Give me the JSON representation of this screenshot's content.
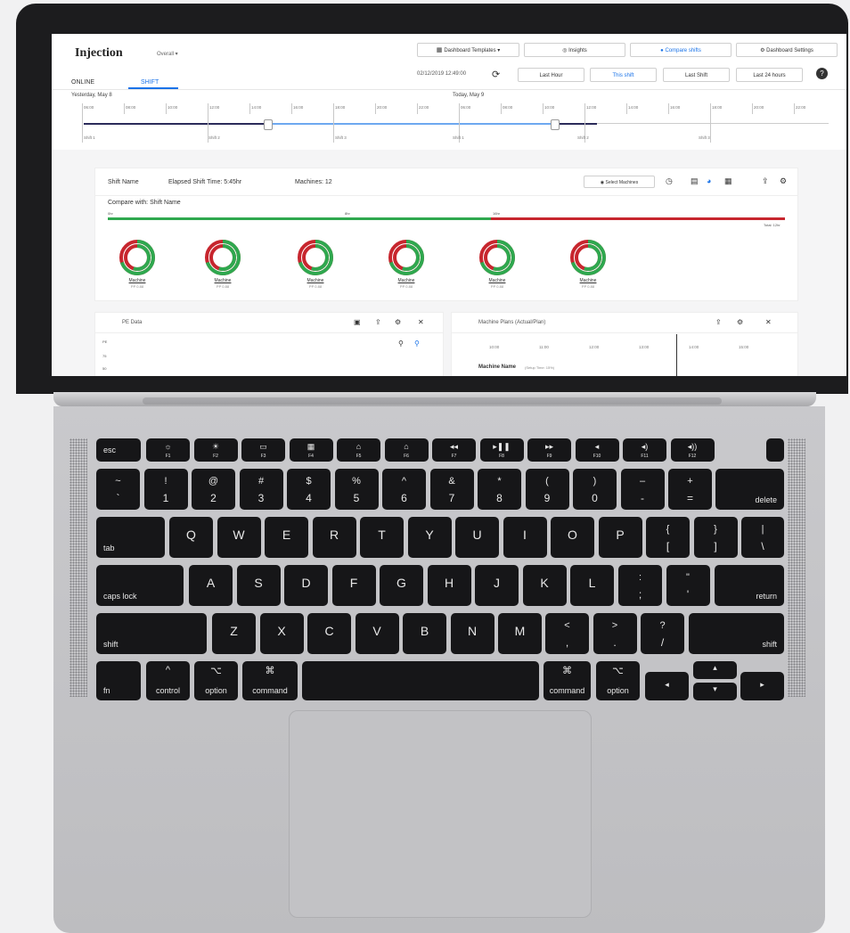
{
  "app": {
    "title": "Injection",
    "title_sub": "Overall ▾",
    "toolbar": {
      "templates": "Dashboard Templates ▾",
      "insights": "Insights",
      "compare": "Compare shifts",
      "settings": "Dashboard Settings"
    },
    "tabs": [
      "ONLINE",
      "SHIFT"
    ],
    "datetime": "02/12/2019 12:49:00",
    "ranges": [
      "Last Hour",
      "This shift",
      "Last Shift",
      "Last 24 hours"
    ],
    "help": "?",
    "timeline": {
      "left_day": "Yesterday, May 8",
      "right_day": "Today, May 9",
      "ticks": [
        "06:00",
        "08:00",
        "10:00",
        "12:00",
        "14:00",
        "16:00",
        "18:00",
        "20:00",
        "22:00",
        "06:00",
        "08:00",
        "10:00",
        "12:00",
        "14:00",
        "16:00",
        "18:00",
        "20:00",
        "22:00"
      ],
      "shifts": [
        "Shift 1",
        "Shift 2",
        "Shift 3",
        "Shift 1",
        "Shift 2",
        "Shift 3"
      ]
    },
    "shift_bar": {
      "name": "Shift Name",
      "elapsed": "Elapsed Shift Time: 5:45hr",
      "machines": "Machines: 12",
      "select": "Select Machines",
      "compare_label": "Compare with: Shift Name",
      "markers": [
        "0hr",
        "8hr",
        "16hr"
      ],
      "total": "Total: 12hr"
    },
    "machines": [
      {
        "name": "Machine",
        "sub": "PP 0.88"
      },
      {
        "name": "Machine",
        "sub": "PP 0.88"
      },
      {
        "name": "Machine",
        "sub": "PP 0.88"
      },
      {
        "name": "Machine",
        "sub": "PP 0.88"
      },
      {
        "name": "Machine",
        "sub": "PP 0.88"
      },
      {
        "name": "Machine",
        "sub": "PP 0.88"
      }
    ],
    "pe_panel": {
      "title": "PE Data",
      "axis": [
        "PE",
        "75",
        "50"
      ]
    },
    "plan_panel": {
      "title": "Machine Plans (Actual/Plan)",
      "ticks": [
        "10:00",
        "11:00",
        "12:00",
        "13:00",
        "14:00",
        "15:00"
      ],
      "machine": "Machine Name",
      "machine_sub": "(Setup Time: 15%)"
    },
    "colors": {
      "accent": "#1a73e8",
      "good": "#2fa84f",
      "bad": "#c7262e"
    }
  },
  "keyboard": {
    "fn_row": [
      "esc",
      "F1",
      "F2",
      "F3",
      "F4",
      "F5",
      "F6",
      "F7",
      "F8",
      "F9",
      "F10",
      "F11",
      "F12"
    ],
    "fn_icons": [
      "",
      "☼",
      "☀",
      "▭",
      "▦",
      "⌂",
      "⌂",
      "◂◂",
      "▸❚❚",
      "▸▸",
      "◂",
      "◂)",
      "◂))"
    ],
    "num_row": [
      [
        "~",
        "`"
      ],
      [
        "!",
        "1"
      ],
      [
        "@",
        "2"
      ],
      [
        "#",
        "3"
      ],
      [
        "$",
        "4"
      ],
      [
        "%",
        "5"
      ],
      [
        "^",
        "6"
      ],
      [
        "&",
        "7"
      ],
      [
        "*",
        "8"
      ],
      [
        "(",
        "9"
      ],
      [
        ")",
        "0"
      ],
      [
        "–",
        "-"
      ],
      [
        "+",
        "="
      ]
    ],
    "delete": "delete",
    "tab": "tab",
    "qrow": [
      "Q",
      "W",
      "E",
      "R",
      "T",
      "Y",
      "U",
      "I",
      "O",
      "P"
    ],
    "qrow_extra": [
      [
        "{",
        "["
      ],
      [
        "}",
        "]"
      ],
      [
        "|",
        "\\"
      ]
    ],
    "caps": "caps lock",
    "arow": [
      "A",
      "S",
      "D",
      "F",
      "G",
      "H",
      "J",
      "K",
      "L"
    ],
    "arow_extra": [
      [
        ":",
        ";"
      ],
      [
        "\"",
        "'"
      ]
    ],
    "return": "return",
    "shift": "shift",
    "zrow": [
      "Z",
      "X",
      "C",
      "V",
      "B",
      "N",
      "M"
    ],
    "zrow_extra": [
      [
        "<",
        ","
      ],
      [
        ">",
        "."
      ],
      [
        "?",
        "/"
      ]
    ],
    "bottom": {
      "fn": "fn",
      "control": "control",
      "control_sym": "^",
      "option": "option",
      "option_sym": "⌥",
      "command": "command",
      "command_sym": "⌘"
    },
    "arrows": [
      "◂",
      "▴",
      "▾",
      "▸"
    ]
  }
}
